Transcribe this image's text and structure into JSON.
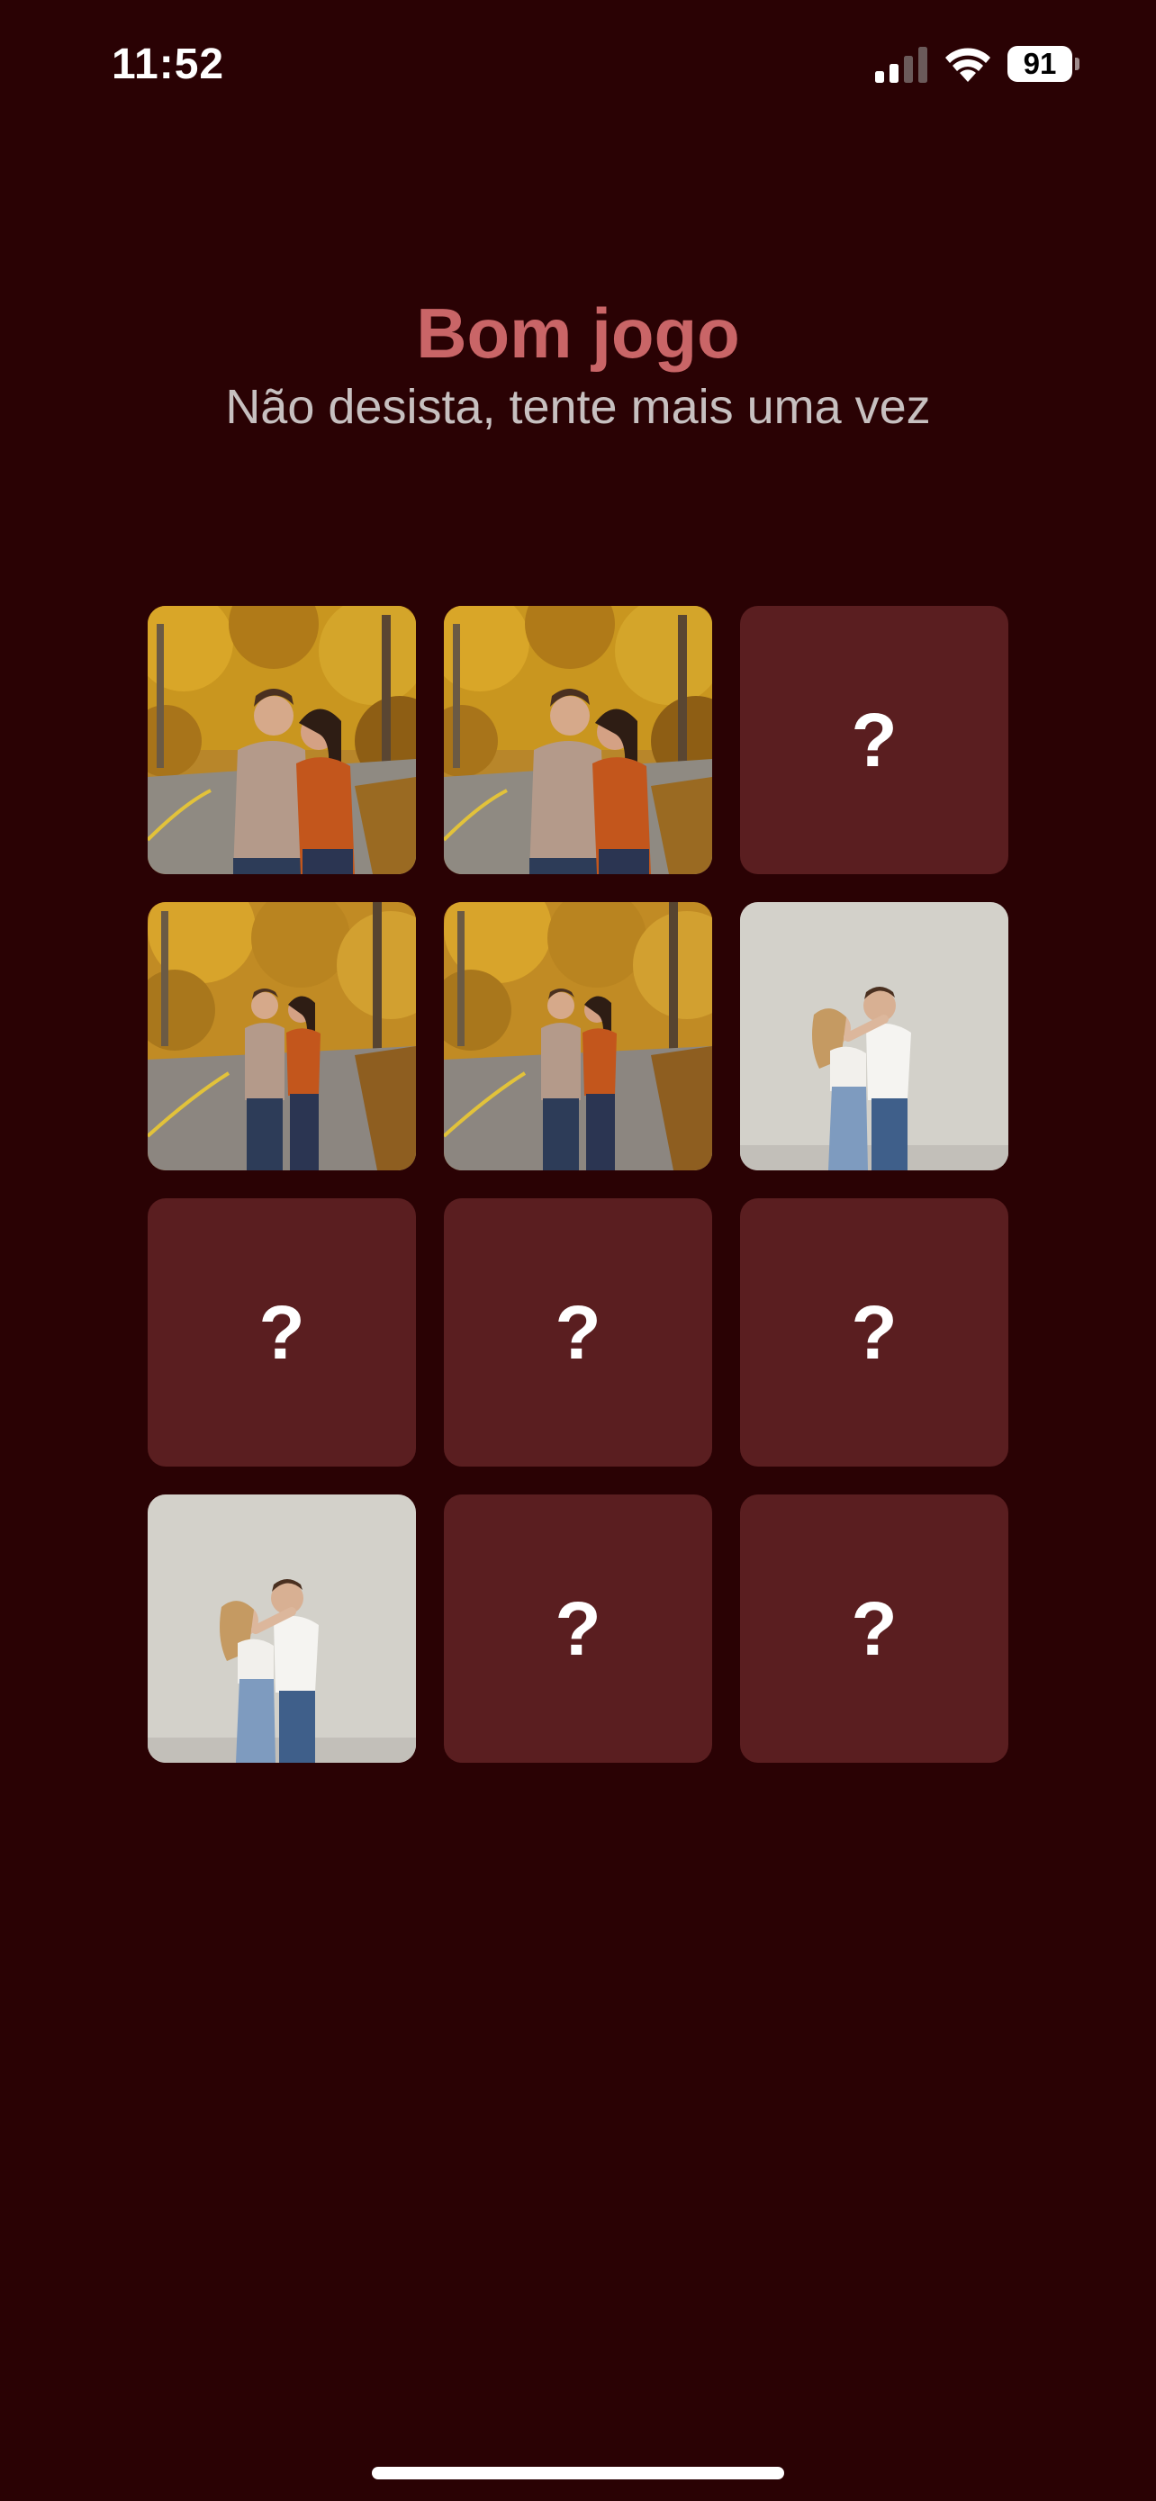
{
  "status_bar": {
    "time": "11:52",
    "battery": "91",
    "icons": [
      "signal-icon",
      "wifi-icon",
      "battery-icon"
    ]
  },
  "header": {
    "title": "Bom jogo",
    "subtitle": "Não desista, tente mais uma vez"
  },
  "colors": {
    "background": "#2a0204",
    "card_back": "#5a1e20",
    "title": "#c96567",
    "subtitle": "#c7c0c0"
  },
  "board": {
    "hidden_symbol": "?",
    "cards": [
      {
        "state": "revealed",
        "photo": "autumn-road-couple-closeup"
      },
      {
        "state": "revealed",
        "photo": "autumn-road-couple-closeup"
      },
      {
        "state": "hidden"
      },
      {
        "state": "revealed",
        "photo": "autumn-road-couple-walking"
      },
      {
        "state": "revealed",
        "photo": "autumn-road-couple-walking"
      },
      {
        "state": "revealed",
        "photo": "studio-couple-kiss"
      },
      {
        "state": "hidden"
      },
      {
        "state": "hidden"
      },
      {
        "state": "hidden"
      },
      {
        "state": "revealed",
        "photo": "studio-couple-kiss"
      },
      {
        "state": "hidden"
      },
      {
        "state": "hidden"
      }
    ]
  }
}
